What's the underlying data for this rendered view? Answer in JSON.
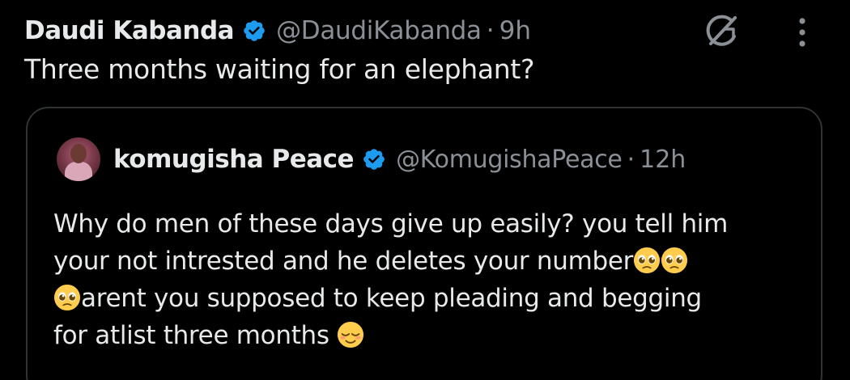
{
  "tweet": {
    "author_name": "Daudi Kabanda",
    "handle": "@DaudiKabanda",
    "separator": "·",
    "time": "9h",
    "text": "Three months waiting for an elephant?"
  },
  "quoted_tweet": {
    "author_name": "komugisha Peace",
    "handle": "@KomugishaPeace",
    "separator": "·",
    "time": "12h",
    "lines": [
      "Why do men of these days give up easily? you tell him",
      "your not intrested and he deletes your number",
      "arent you supposed to keep pleading and begging",
      "for atlist three months"
    ]
  },
  "icons": {
    "verified": "verified-badge-icon",
    "grok": "grok-icon",
    "more": "more-vertical-icon",
    "pleading": "pleading-face-emoji",
    "relieved": "relieved-face-emoji"
  },
  "colors": {
    "background": "#000000",
    "text": "#e7e9ea",
    "secondary_text": "#8b9097",
    "verified_blue": "#1d9bf0",
    "border": "#2f3336"
  }
}
